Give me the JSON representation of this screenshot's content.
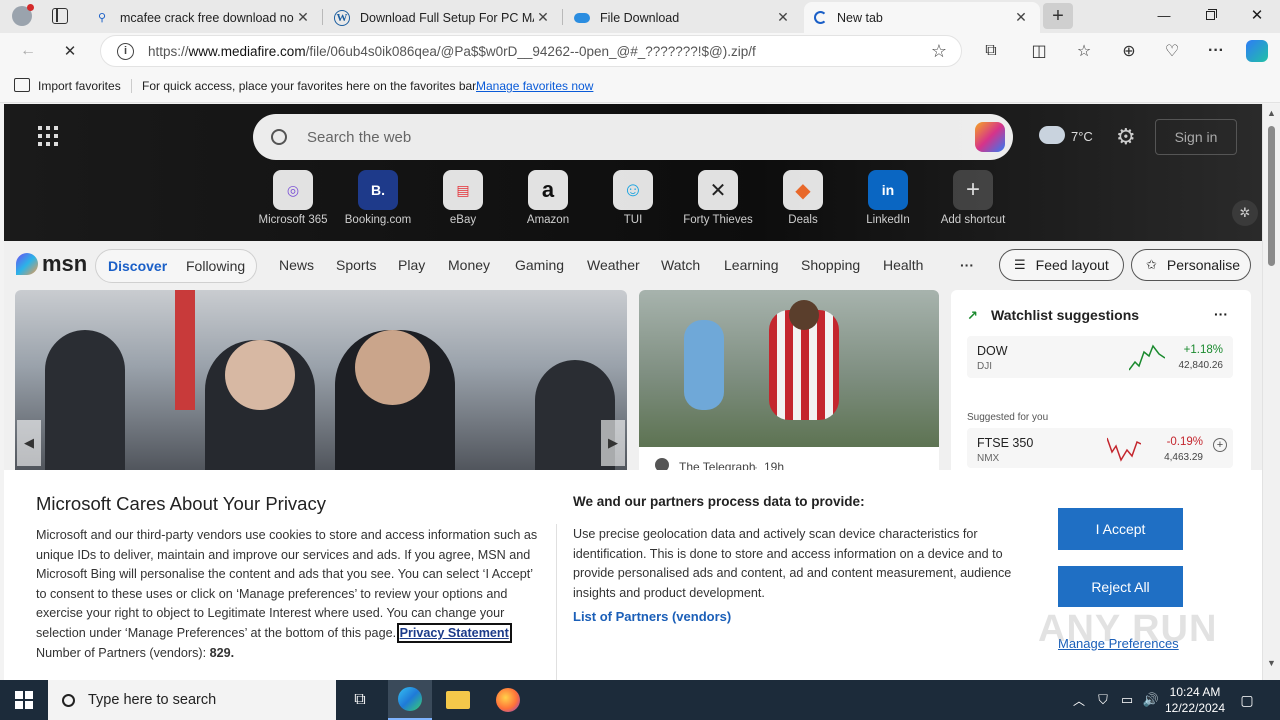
{
  "browser": {
    "tabs": [
      {
        "label": "mcafee crack free download no v",
        "icon": "search-icon",
        "active": false
      },
      {
        "label": "Download Full Setup For PC MAC",
        "icon": "wordpress-icon",
        "active": false
      },
      {
        "label": "File Download",
        "icon": "download-site-icon",
        "active": false
      },
      {
        "label": "New tab",
        "icon": "loading-icon",
        "active": true
      }
    ],
    "new_tab_symbol": "+",
    "url_prefix": "https://",
    "url_host": "www.mediafire.com",
    "url_path": "/file/06ub4s0ik086qea/@Pa$$w0rD__94262--0pen_@#_???????!$@).zip/f"
  },
  "favorites_bar": {
    "import_label": "Import favorites",
    "hint_text": "For quick access, place your favorites here on the favorites bar.",
    "manage_link": "Manage favorites now"
  },
  "msn": {
    "search_placeholder": "Search the web",
    "weather_temp": "7°C",
    "sign_in": "Sign in",
    "shortcuts": [
      {
        "label": "Microsoft 365",
        "glyph": "◎"
      },
      {
        "label": "Booking.com",
        "glyph": "B."
      },
      {
        "label": "eBay",
        "glyph": "▤"
      },
      {
        "label": "Amazon",
        "glyph": "a"
      },
      {
        "label": "TUI",
        "glyph": "☺"
      },
      {
        "label": "Forty Thieves",
        "glyph": "✕"
      },
      {
        "label": "Deals",
        "glyph": "◆"
      },
      {
        "label": "LinkedIn",
        "glyph": "in"
      },
      {
        "label": "Add shortcut",
        "glyph": "+"
      }
    ],
    "logo": "msn",
    "tab_discover": "Discover",
    "tab_following": "Following",
    "nav": [
      "News",
      "Sports",
      "Play",
      "Money",
      "Gaming",
      "Weather",
      "Watch",
      "Learning",
      "Shopping",
      "Health"
    ],
    "more": "···",
    "feed_layout": "Feed layout",
    "personalise": "Personalise",
    "second_card_source": "The Telegraph",
    "second_card_time": "19h",
    "watchlist": {
      "title": "Watchlist suggestions",
      "more": "···",
      "items": [
        {
          "symbol": "DOW",
          "sub": "DJI",
          "change": "+1.18%",
          "value": "42,840.26",
          "color": "#1a8a2e"
        }
      ],
      "suggested_label": "Suggested for you",
      "suggested": [
        {
          "symbol": "FTSE 350",
          "sub": "NMX",
          "change": "-0.19%",
          "value": "4,463.29",
          "color": "#c4262e"
        }
      ]
    }
  },
  "consent": {
    "title": "Microsoft Cares About Your Privacy",
    "body": "Microsoft and our third-party vendors use cookies to store and access information such as unique IDs to deliver, maintain and improve our services and ads. If you agree, MSN and Microsoft Bing will personalise the content and ads that you see. You can select ‘I Accept’ to consent to these uses or click on ‘Manage preferences’ to review your options and exercise your right to object to Legitimate Interest where used.  You can change your selection under ‘Manage Preferences’ at the bottom of this page.",
    "privacy_link": "Privacy Statement",
    "partners_count_label": "Number of Partners (vendors):",
    "partners_count": "829.",
    "right_title": "We and our partners process data to provide:",
    "right_body": "Use precise geolocation data and actively scan device characteristics for identification. This is done to store and access information on a device and to provide personalised ads and content, ad and content measurement, audience insights and product development.",
    "partners_link": "List of Partners (vendors)",
    "accept": "I Accept",
    "reject": "Reject All",
    "manage": "Manage Preferences"
  },
  "watermark": "ANY RUN",
  "taskbar": {
    "search_placeholder": "Type here to search",
    "time": "10:24 AM",
    "date": "12/22/2024"
  }
}
